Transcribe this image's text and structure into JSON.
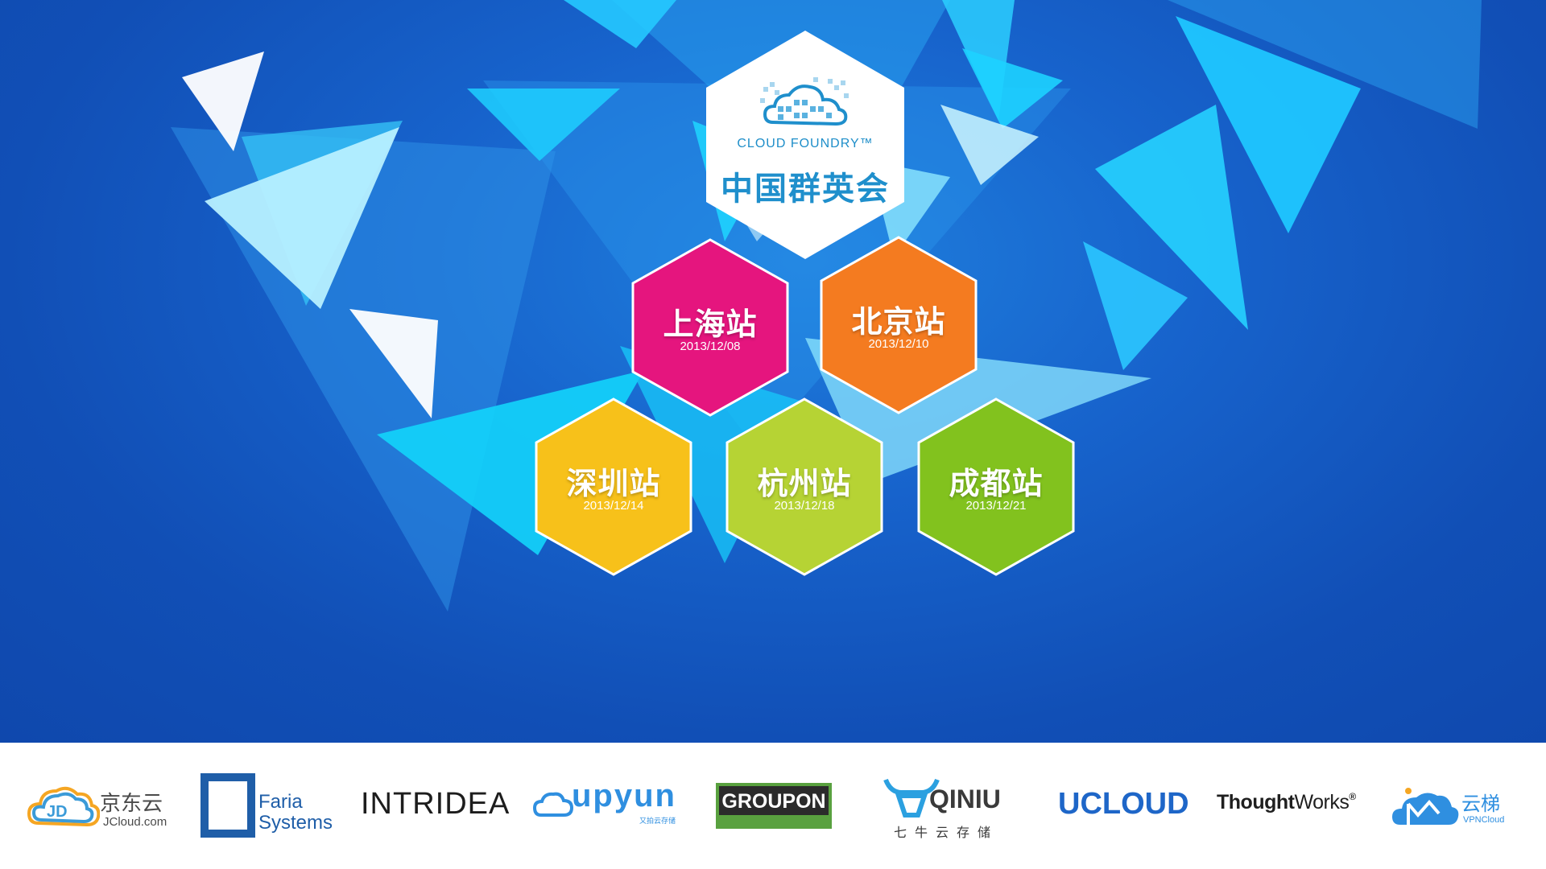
{
  "event": {
    "brand": "CLOUD FOUNDRY™",
    "title": "中国群英会"
  },
  "stations": [
    {
      "city": "上海站",
      "date": "2013/12/08",
      "color": "#e5157e"
    },
    {
      "city": "北京站",
      "date": "2013/12/10",
      "color": "#f47b20"
    },
    {
      "city": "深圳站",
      "date": "2013/12/14",
      "color": "#f7c11a"
    },
    {
      "city": "杭州站",
      "date": "2013/12/18",
      "color": "#b6d334"
    },
    {
      "city": "成都站",
      "date": "2013/12/21",
      "color": "#82c21e"
    }
  ],
  "colors": {
    "background": "#1557c0",
    "accent_cyan": "#1fd0ff",
    "logo_blue": "#1f8fcc"
  },
  "sponsors": {
    "jd": {
      "name": "京东云",
      "sub": "JCloud.com",
      "icon": "jd-cloud-logo-icon"
    },
    "faria": {
      "line1": "Faria",
      "line2": "Systems",
      "icon": "faria-square-logo-icon"
    },
    "intridea": {
      "name": "INTRIDEA"
    },
    "upyun": {
      "name": "upyun",
      "sub": "又拍云存储",
      "icon": "upyun-cloud-icon"
    },
    "groupon": {
      "name": "GROUPON"
    },
    "qiniu": {
      "name": "QINIU",
      "sub": "七牛云存储",
      "icon": "qiniu-bull-icon"
    },
    "ucloud": {
      "name": "UCLOUD"
    },
    "thoughtworks": {
      "bold": "Thought",
      "light": "Works",
      "mark": "®"
    },
    "yunti": {
      "name": "云梯",
      "sub": "VPNCloud",
      "icon": "yunti-cloud-icon"
    }
  }
}
